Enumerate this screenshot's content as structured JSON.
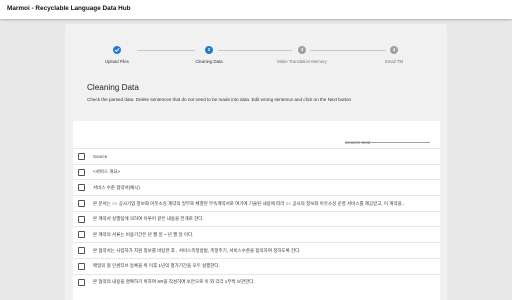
{
  "app": {
    "title": "Marmoi - Recyclable Language Data Hub"
  },
  "stepper": {
    "steps": [
      {
        "number": "1",
        "label": "Upload Files",
        "state": "done"
      },
      {
        "number": "2",
        "label": "Cleaning Data",
        "state": "active"
      },
      {
        "number": "3",
        "label": "Make Translation Memory",
        "state": "todo"
      },
      {
        "number": "4",
        "label": "Email TM",
        "state": "todo"
      }
    ]
  },
  "main": {
    "heading": "Cleaning Data",
    "instructions": "Check the parsed data.  Delete sentences that do not need to be made into data.  Edit wrong sentence and click on the Next button"
  },
  "table": {
    "search_placeholder": "Search field",
    "header": "Source",
    "rows": [
      "<서비스 개요>",
      "서비스 수준 협약서(예시)",
      "본 문서는 ○○ 공사기업 정보화 아웃소싱 계약의 일부로 체결된 부속계약서로 여기에 기술된 내용에 따라 ○○ 공사의 정보화 아웃소싱 운영 서비스를 제공받고, 이 계약을...",
      "본 계약서 실행팀에 의하여 이루어 같은 내용을 전개로 한다.",
      "본 계약의 서류는 비용기간은 년 월 일 ~ 년 월 일 이다.",
      "본 협약서는 사업자가 지원 정보를 바탕한 후 , 서비스측정방법, 측정주기, 서비스수준을 합의하여 정하도록 한다.",
      "매일의 협 인센티브 등록을 위 이후 1년의 평가기간을 모두 실행한다.",
      "본 협약의 내용을 명확하기 위하여 SR을 작성하여 보안으로 이 외 각각 1부씩 보관한다."
    ]
  },
  "colors": {
    "accent": "#1f7ad2",
    "inactive_step": "#9e9e9e",
    "background": "#e8e8e8",
    "panel": "#f1f1f1",
    "card": "#ffffff"
  },
  "icons": {
    "done_step": "check-icon"
  }
}
